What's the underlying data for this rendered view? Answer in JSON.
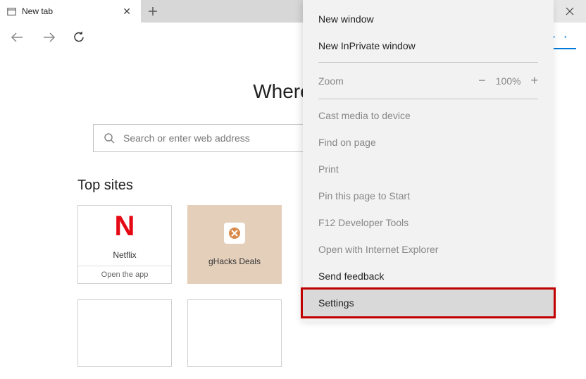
{
  "tab": {
    "title": "New tab"
  },
  "page": {
    "headline": "Where to",
    "search_placeholder": "Search or enter web address",
    "top_sites_label": "Top sites"
  },
  "tiles": {
    "netflix": {
      "symbol": "N",
      "label": "Netflix",
      "footer": "Open the app"
    },
    "ghacks": {
      "label": "gHacks Deals"
    }
  },
  "menu": {
    "new_window": "New window",
    "new_inprivate": "New InPrivate window",
    "zoom_label": "Zoom",
    "zoom_value": "100%",
    "cast": "Cast media to device",
    "find": "Find on page",
    "print": "Print",
    "pin": "Pin this page to Start",
    "devtools": "F12 Developer Tools",
    "open_ie": "Open with Internet Explorer",
    "feedback": "Send feedback",
    "settings": "Settings"
  }
}
